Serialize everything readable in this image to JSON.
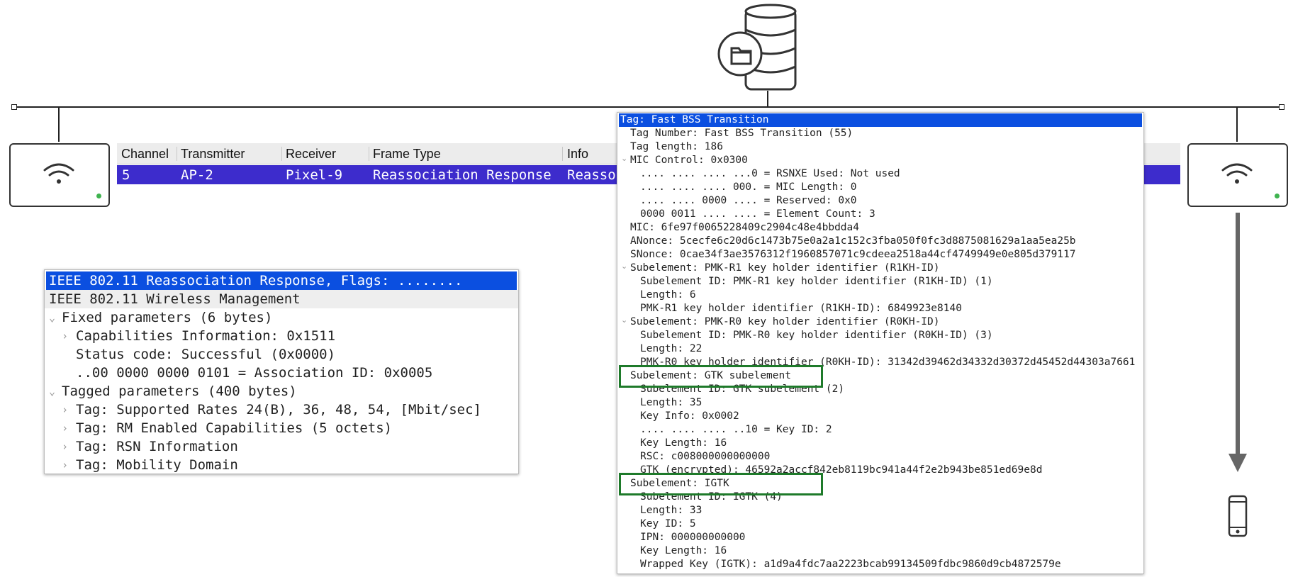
{
  "topology": {
    "server_icon": "database-server-icon",
    "left_ap_icon": "wifi-icon",
    "right_ap_icon": "wifi-icon",
    "client_icon": "smartphone-icon",
    "status_led_color": "#3fb34f"
  },
  "packet_list": {
    "columns": [
      "Channel",
      "Transmitter",
      "Receiver",
      "Frame Type",
      "Info"
    ],
    "selected_row": {
      "channel": "5",
      "transmitter": "AP-2",
      "receiver": "Pixel-9",
      "frame_type": "Reassociation Response",
      "info": "Reassoc"
    },
    "selection_color": "#3d2ccc"
  },
  "detail_tree": {
    "rows": [
      "IEEE 802.11 Reassociation Response, Flags: ........",
      "IEEE 802.11 Wireless Management",
      "Fixed parameters (6 bytes)",
      "Capabilities Information: 0x1511",
      "Status code: Successful (0x0000)",
      "..00 0000 0000 0101 = Association ID: 0x0005",
      "Tagged parameters (400 bytes)",
      "Tag: Supported Rates 24(B), 36, 48, 54, [Mbit/sec]",
      "Tag: RM Enabled Capabilities (5 octets)",
      "Tag: RSN Information",
      "Tag: Mobility Domain"
    ]
  },
  "ft_popup": {
    "rows": [
      "Tag: Fast BSS Transition",
      "Tag Number: Fast BSS Transition (55)",
      "Tag length: 186",
      "MIC Control: 0x0300",
      ".... .... .... ...0 = RSNXE Used: Not used",
      ".... .... .... 000. = MIC Length: 0",
      ".... .... 0000 .... = Reserved: 0x0",
      "0000 0011 .... .... = Element Count: 3",
      "MIC: 6fe97f0065228409c2904c48e4bbdda4",
      "ANonce: 5cecfe6c20d6c1473b75e0a2a1c152c3fba050f0fc3d8875081629a1aa5ea25b",
      "SNonce: 0cae34f3ae3576312f1960857071c9cdeea2518a44cf4749949e0e805d379117",
      "Subelement: PMK-R1 key holder identifier (R1KH-ID)",
      "Subelement ID: PMK-R1 key holder identifier (R1KH-ID) (1)",
      "Length: 6",
      "PMK-R1 key holder identifier (R1KH-ID): 6849923e8140",
      "Subelement: PMK-R0 key holder identifier (R0KH-ID)",
      "Subelement ID: PMK-R0 key holder identifier (R0KH-ID) (3)",
      "Length: 22",
      "PMK-R0 key holder identifier (R0KH-ID): 31342d39462d34332d30372d45452d44303a7661",
      "Subelement: GTK subelement",
      "Subelement ID: GTK subelement (2)",
      "Length: 35",
      "Key Info: 0x0002",
      ".... .... .... ..10 = Key ID: 2",
      "Key Length: 16",
      "RSC: c008000000000000",
      "GTK (encrypted): 46592a2accf842eb8119bc941a44f2e2b943be851ed69e8d",
      "Subelement: IGTK",
      "Subelement ID: IGTK (4)",
      "Length: 33",
      "Key ID: 5",
      "IPN: 000000000000",
      "Key Length: 16",
      "Wrapped Key (IGTK): a1d9a4fdc7aa2223bcab99134509fdbc9860d9cb4872579e"
    ],
    "highlight_color": "#1e7a2a"
  }
}
